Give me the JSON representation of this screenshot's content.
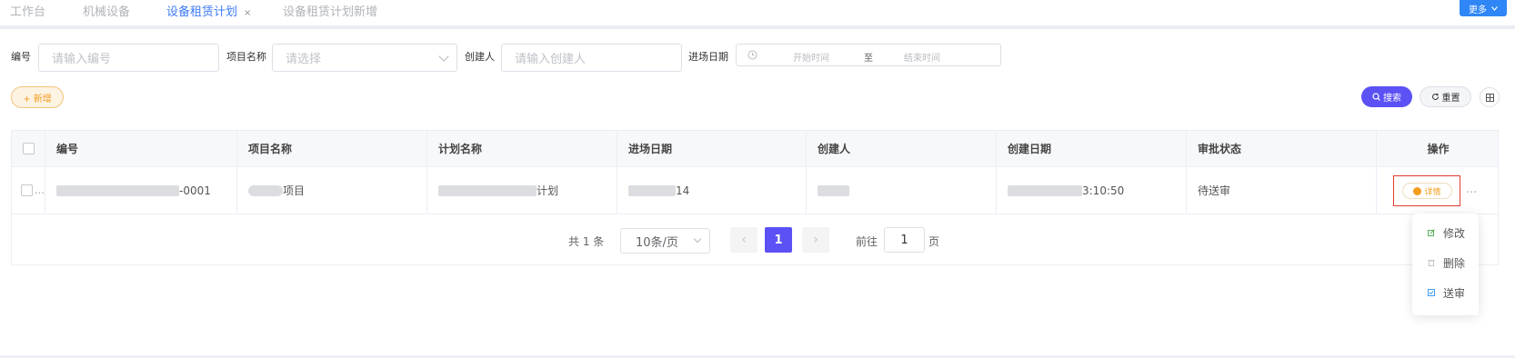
{
  "tabs": [
    {
      "label": "工作台"
    },
    {
      "label": "机械设备"
    },
    {
      "label": "设备租赁计划",
      "active": true,
      "close": "×"
    },
    {
      "label": "设备租赁计划新增"
    }
  ],
  "more_button": {
    "label": "更多"
  },
  "filters": {
    "code": {
      "label": "编号",
      "placeholder": "请输入编号"
    },
    "project": {
      "label": "项目名称",
      "placeholder": "请选择"
    },
    "creator": {
      "label": "创建人",
      "placeholder": "请输入创建人"
    },
    "entry_date": {
      "label": "进场日期",
      "start_placeholder": "开始时间",
      "separator": "至",
      "end_placeholder": "结束时间"
    }
  },
  "toolbar": {
    "add_label": "+ 新增",
    "search_label": "搜索",
    "reset_label": "重置"
  },
  "table": {
    "columns": [
      "编号",
      "项目名称",
      "计划名称",
      "进场日期",
      "创建人",
      "创建日期",
      "审批状态",
      "操作"
    ],
    "rows": [
      {
        "code": "-0001",
        "project": "项目",
        "plan_name": "计划",
        "entry_date": "14",
        "creator": "",
        "created_date": "3:10:50",
        "status": "待送审",
        "action_label": "详情",
        "ellipsis": "..."
      }
    ]
  },
  "pagination": {
    "total": "共 1 条",
    "page_size": "10条/页",
    "prev": "‹",
    "current": "1",
    "next": "›",
    "goto_prefix": "前往",
    "goto_value": "1",
    "goto_suffix": "页"
  },
  "dropdown": {
    "items": [
      {
        "label": "修改",
        "icon": "edit-icon"
      },
      {
        "label": "删除",
        "icon": "delete-icon"
      },
      {
        "label": "送审",
        "icon": "submit-icon"
      }
    ]
  },
  "colors": {
    "primary": "#5b51f5",
    "tab_active": "#3f7cf6",
    "warning": "#f39b1c",
    "highlight_border": "#e23b31"
  }
}
